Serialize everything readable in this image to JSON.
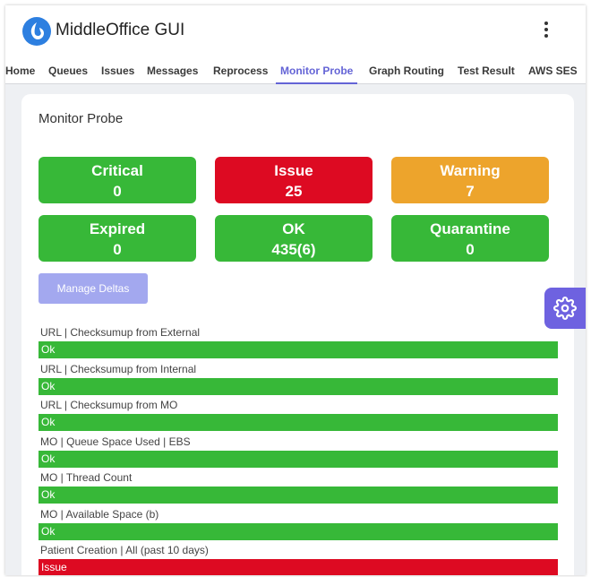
{
  "app": {
    "title": "MiddleOffice GUI"
  },
  "colors": {
    "green": "#37b838",
    "red": "#dd0a22",
    "orange": "#eda42c",
    "accent": "#6464d6",
    "button": "#a3a8ef"
  },
  "tabs": [
    {
      "label": "Home",
      "active": false
    },
    {
      "label": "Queues",
      "active": false
    },
    {
      "label": "Issues",
      "active": false
    },
    {
      "label": "Messages",
      "active": false
    },
    {
      "label": "Reprocess",
      "active": false
    },
    {
      "label": "Monitor Probe",
      "active": true
    },
    {
      "label": "Graph Routing",
      "active": false
    },
    {
      "label": "Test Result",
      "active": false
    },
    {
      "label": "AWS SES",
      "active": false
    }
  ],
  "page": {
    "title": "Monitor Probe"
  },
  "stats": [
    {
      "label": "Critical",
      "value": "0",
      "color": "green"
    },
    {
      "label": "Issue",
      "value": "25",
      "color": "red"
    },
    {
      "label": "Warning",
      "value": "7",
      "color": "orange"
    },
    {
      "label": "Expired",
      "value": "0",
      "color": "green"
    },
    {
      "label": "OK",
      "value": "435(6)",
      "color": "green"
    },
    {
      "label": "Quarantine",
      "value": "0",
      "color": "green"
    }
  ],
  "manage_button": "Manage Deltas",
  "probes": [
    {
      "name": "URL | Checksumup from External",
      "status": "Ok"
    },
    {
      "name": "URL | Checksumup from Internal",
      "status": "Ok"
    },
    {
      "name": "URL | Checksumup from MO",
      "status": "Ok"
    },
    {
      "name": "MO | Queue Space Used | EBS",
      "status": "Ok"
    },
    {
      "name": "MO | Thread Count",
      "status": "Ok"
    },
    {
      "name": "MO | Available Space (b)",
      "status": "Ok"
    },
    {
      "name": "Patient Creation | All (past 10 days)",
      "status": "Issue"
    }
  ],
  "icons": {
    "logo": "app-logo-icon",
    "menu": "kebab-menu-icon",
    "settings": "gear-icon"
  }
}
